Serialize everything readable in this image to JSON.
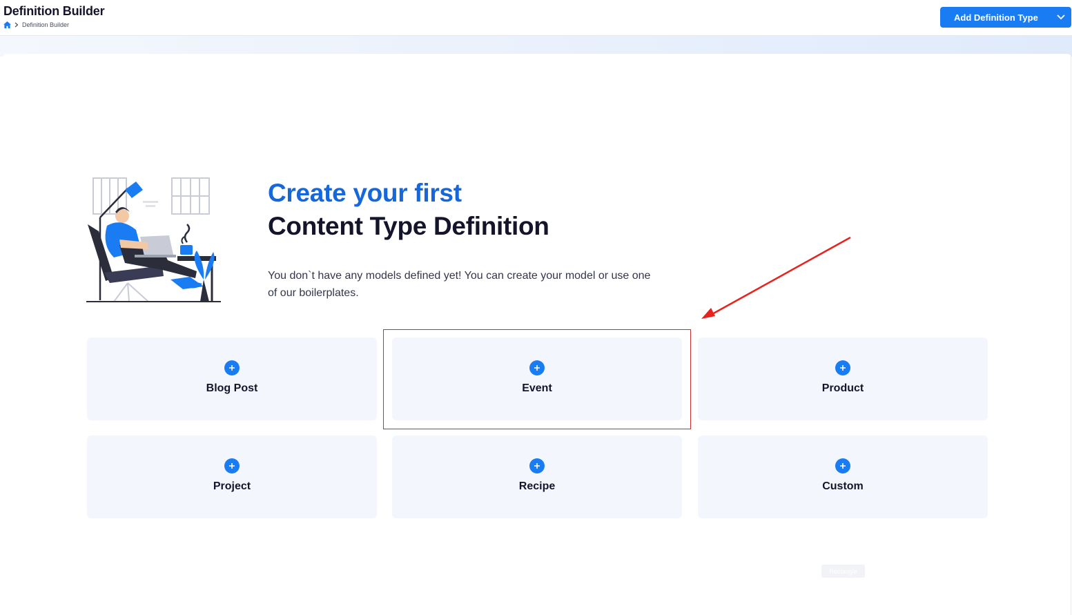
{
  "header": {
    "title": "Definition Builder",
    "breadcrumb": {
      "home_icon": "home-icon",
      "separator_icon": "chevron-right-icon",
      "current": "Definition Builder"
    },
    "add_button": {
      "label": "Add Definition Type",
      "icon": "chevron-down-icon"
    }
  },
  "hero": {
    "illustration": "person-working-on-laptop-illustration",
    "headline_line1": "Create your first",
    "headline_line2": "Content Type Definition",
    "description": "You don`t have any models defined yet! You can create your model or use one of our boilerplates."
  },
  "boilerplates": [
    {
      "label": "Blog Post",
      "icon": "plus-circle-icon"
    },
    {
      "label": "Event",
      "icon": "plus-circle-icon"
    },
    {
      "label": "Product",
      "icon": "plus-circle-icon"
    },
    {
      "label": "Project",
      "icon": "plus-circle-icon"
    },
    {
      "label": "Recipe",
      "icon": "plus-circle-icon"
    },
    {
      "label": "Custom",
      "icon": "plus-circle-icon"
    }
  ],
  "annotation": {
    "highlighted_item": "Event",
    "color": "#d42a2a"
  },
  "ghost_label": "Rectangle",
  "colors": {
    "accent": "#1a7cf2",
    "headline_blue": "#1667d9",
    "card_bg": "#f4f6fd",
    "text_dark": "#14142b"
  }
}
